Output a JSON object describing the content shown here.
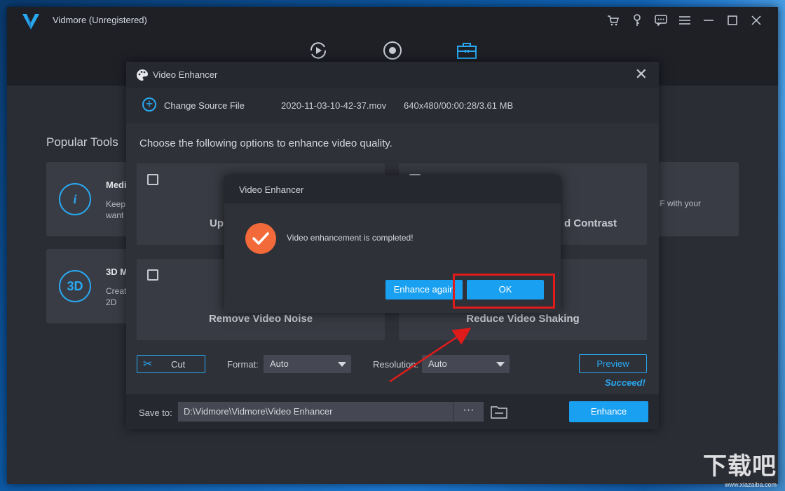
{
  "app": {
    "title": "Vidmore (Unregistered)"
  },
  "home": {
    "popular_title": "Popular Tools",
    "cards": [
      {
        "icon": "i",
        "name": "Medi",
        "desc_line1": "Keep",
        "desc_line2": "want"
      },
      {
        "icon": "3D",
        "name": "3D M",
        "desc_line1": "Creat",
        "desc_line2": "2D"
      }
    ],
    "right_card_text": "IF with your"
  },
  "enhancer": {
    "title": "Video Enhancer",
    "change_source": "Change Source File",
    "file_name": "2020-11-03-10-42-37.mov",
    "file_info": "640x480/00:00:28/3.61 MB",
    "instruction": "Choose the following options to enhance video quality.",
    "options": [
      {
        "label": "Up"
      },
      {
        "label": "d Contrast"
      },
      {
        "label": "Remove Video Noise"
      },
      {
        "label": "Reduce Video Shaking"
      }
    ],
    "cut_label": "Cut",
    "format_label": "Format:",
    "format_value": "Auto",
    "resolution_label": "Resolution:",
    "resolution_value": "Auto",
    "preview_label": "Preview",
    "status": "Succeed!",
    "save_label": "Save to:",
    "save_path": "D:\\Vidmore\\Vidmore\\Video Enhancer",
    "dots": "···",
    "enhance_label": "Enhance"
  },
  "dialog": {
    "title": "Video Enhancer",
    "message": "Video enhancement is completed!",
    "again_label": "Enhance again",
    "ok_label": "OK"
  },
  "watermark": {
    "main": "下载吧",
    "sub": "www.xiazaiba.com"
  },
  "colors": {
    "accent": "#1aa0f0",
    "success_icon": "#f26a3a",
    "highlight": "#e01b1b"
  }
}
